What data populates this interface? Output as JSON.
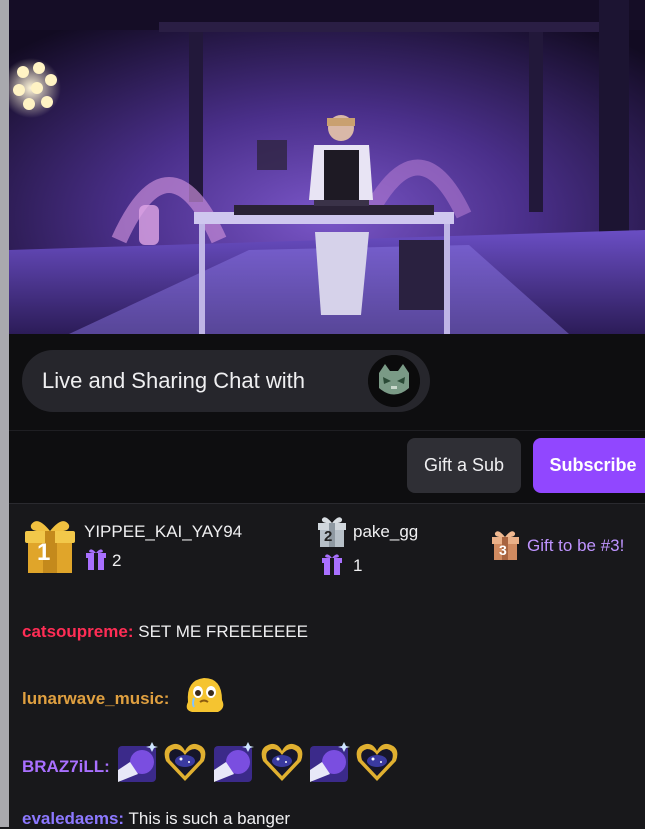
{
  "colors": {
    "background": "#18181b",
    "accent": "#9147ff",
    "accent_light": "#bf94ff"
  },
  "video": {
    "icon_name": "live-video-dj-performance"
  },
  "live_banner": {
    "text": "Live and Sharing Chat with",
    "avatar_icon": "cat-avatar-icon"
  },
  "actions": {
    "gift_label": "Gift a Sub",
    "subscribe_label": "Subscribe"
  },
  "leaderboard": {
    "gifters": [
      {
        "rank": "1",
        "name": "YIPPEE_KAI_YAY94",
        "count": "2",
        "badge_color": "#e0a52a"
      },
      {
        "rank": "2",
        "name": "pake_gg",
        "count": "1",
        "badge_color": "#b7c0c8"
      }
    ],
    "cta": {
      "rank": "3",
      "label": "Gift to be #3!"
    }
  },
  "chat": {
    "messages": [
      {
        "user": "catsoupreme",
        "sep": ":",
        "text": "SET ME FREEEEEEE",
        "color": "#ff2d55"
      },
      {
        "user": "lunarwave_music",
        "sep": ":",
        "text": "",
        "color": "#e0a040",
        "emotes": [
          "crying-yellow-blob-emote"
        ]
      },
      {
        "user": "BRAZ7iLL",
        "sep": ":",
        "text": "",
        "color": "#a970ff",
        "emotes": [
          "purple-sparkle-emote",
          "gold-heart-emote",
          "purple-sparkle-emote",
          "gold-heart-emote",
          "purple-sparkle-emote",
          "gold-heart-emote"
        ]
      },
      {
        "user": "evaledaems",
        "sep": ":",
        "text": "This is such a banger",
        "color": "#8c78ff"
      }
    ]
  }
}
